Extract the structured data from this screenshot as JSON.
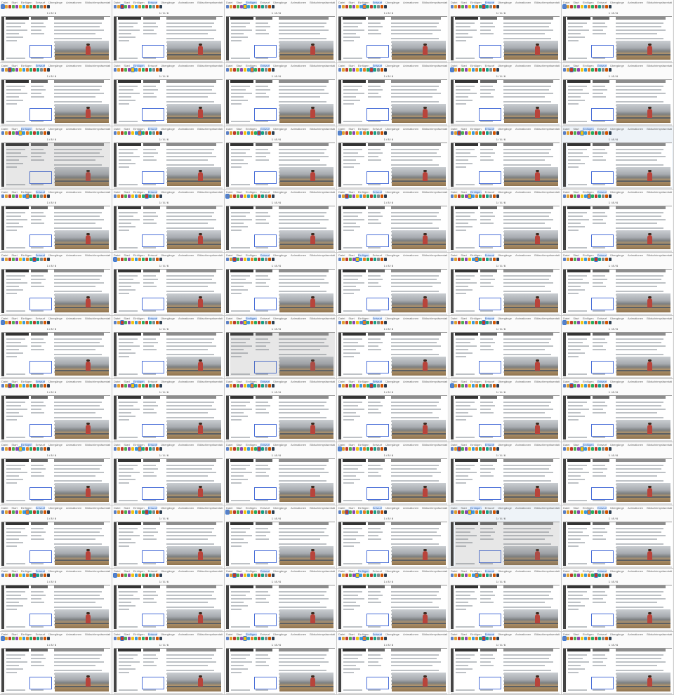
{
  "grid": {
    "columns": 6,
    "rows": 11
  },
  "ribbon_tabs": [
    "Datei",
    "Start",
    "Einfügen",
    "Entwurf",
    "Übergänge",
    "Animationen",
    "Bildschirmpräsentation",
    "Überprüfen",
    "Ansicht",
    "Hilfe"
  ],
  "ribbon_icon_colors": [
    "#5a7fc4",
    "#e0a030",
    "#c0392b",
    "#4caf50",
    "#8e44ad",
    "#f1c40f",
    "#3b9bd8",
    "#e67e22",
    "#27ae60",
    "#c0392b",
    "#16a085",
    "#7f8c8d",
    "#d35400",
    "#2c3e50"
  ],
  "slide_number": "1 / 8 / 6",
  "accent_color": "#3a7bd5",
  "selection_color": "#4a6fd8",
  "photo_icon": "photo-thumbnail-icon",
  "frames": [
    {
      "active_tab": -1,
      "selected_icon": 0,
      "has_footnote": false
    },
    {
      "active_tab": 3,
      "selected_icon": 2,
      "has_footnote": false
    },
    {
      "active_tab": 2,
      "selected_icon": 5,
      "has_footnote": false
    },
    {
      "active_tab": 3,
      "selected_icon": 7,
      "has_footnote": true
    },
    {
      "active_tab": 3,
      "selected_icon": 9,
      "has_footnote": false
    }
  ]
}
